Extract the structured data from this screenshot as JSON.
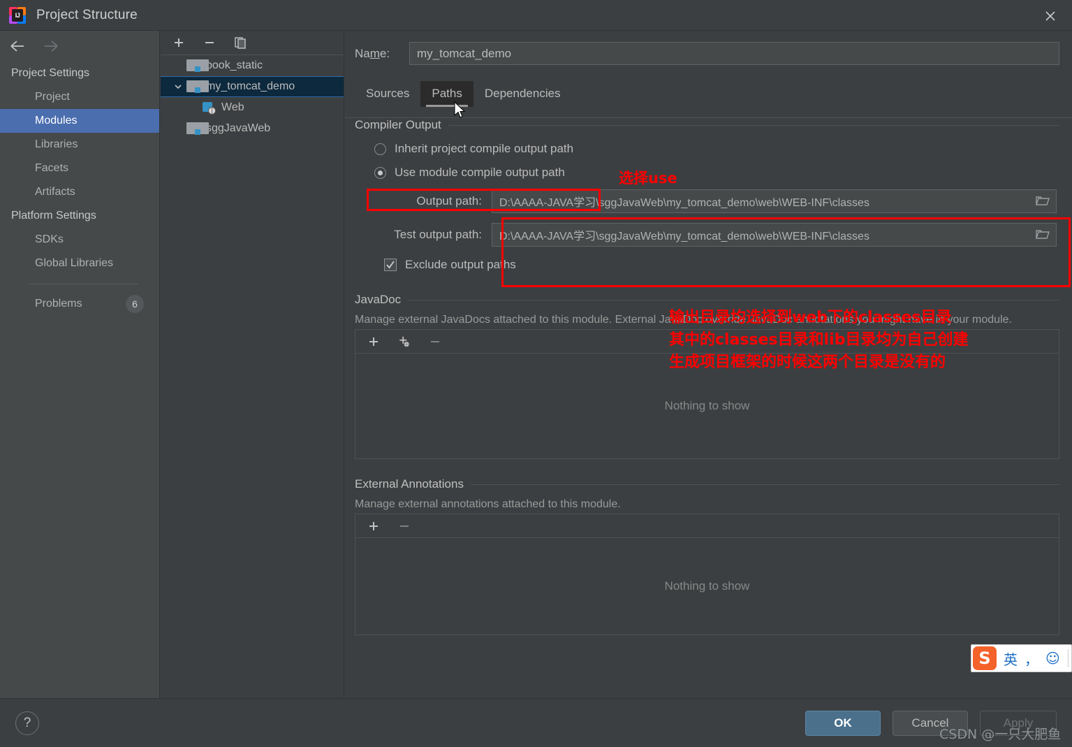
{
  "window": {
    "title": "Project Structure",
    "close_icon": "close-icon",
    "logo_text": "IJ"
  },
  "sidebar": {
    "back_icon": "arrow-left-icon",
    "forward_icon": "arrow-right-icon",
    "groups": [
      {
        "label": "Project Settings",
        "items": [
          {
            "label": "Project",
            "selected": false
          },
          {
            "label": "Modules",
            "selected": true
          },
          {
            "label": "Libraries",
            "selected": false
          },
          {
            "label": "Facets",
            "selected": false
          },
          {
            "label": "Artifacts",
            "selected": false
          }
        ]
      },
      {
        "label": "Platform Settings",
        "items": [
          {
            "label": "SDKs",
            "selected": false
          },
          {
            "label": "Global Libraries",
            "selected": false
          }
        ]
      }
    ],
    "problems": {
      "label": "Problems",
      "count": "6"
    }
  },
  "tree": {
    "toolbar": [
      {
        "name": "add-module-button",
        "icon": "plus-icon"
      },
      {
        "name": "remove-module-button",
        "icon": "minus-icon"
      },
      {
        "name": "copy-module-button",
        "icon": "copy-icon"
      }
    ],
    "nodes": [
      {
        "label": "book_static",
        "icon": "module-folder-icon",
        "indent": 1,
        "expander": "",
        "selected": false
      },
      {
        "label": "my_tomcat_demo",
        "icon": "module-folder-icon",
        "indent": 0,
        "expander": "chevron-down-icon",
        "selected": true
      },
      {
        "label": "Web",
        "icon": "web-facet-icon",
        "indent": 2,
        "expander": "",
        "selected": false
      },
      {
        "label": "sggJavaWeb",
        "icon": "module-folder-icon",
        "indent": 1,
        "expander": "",
        "selected": false
      }
    ]
  },
  "main": {
    "name_label": "Name:",
    "name_value": "my_tomcat_demo",
    "tabs": [
      {
        "label": "Sources",
        "active": false
      },
      {
        "label": "Paths",
        "active": true
      },
      {
        "label": "Dependencies",
        "active": false
      }
    ],
    "compiler_output": {
      "section_title": "Compiler Output",
      "radio_inherit": "Inherit project compile output path",
      "radio_use": "Use module compile output path",
      "selected": "use",
      "output_path_label": "Output path:",
      "output_path_value": "D:\\AAAA-JAVA学习\\sggJavaWeb\\my_tomcat_demo\\web\\WEB-INF\\classes",
      "test_output_path_label": "Test output path:",
      "test_output_path_value": "D:\\AAAA-JAVA学习\\sggJavaWeb\\my_tomcat_demo\\web\\WEB-INF\\classes",
      "browse_icon": "folder-browse-icon",
      "exclude_label": "Exclude output paths",
      "exclude_checked": true
    },
    "javadoc": {
      "section_title": "JavaDoc",
      "description": "Manage external JavaDocs attached to this module. External JavaDoc override JavaDoc annotations you might have in your module.",
      "toolbar": [
        {
          "name": "javadoc-add-button",
          "icon": "plus-icon"
        },
        {
          "name": "javadoc-add-url-button",
          "icon": "plus-globe-icon"
        },
        {
          "name": "javadoc-remove-button",
          "icon": "minus-icon"
        }
      ],
      "empty_text": "Nothing to show"
    },
    "external_annotations": {
      "section_title": "External Annotations",
      "description": "Manage external annotations attached to this module.",
      "toolbar": [
        {
          "name": "annotations-add-button",
          "icon": "plus-icon"
        },
        {
          "name": "annotations-remove-button",
          "icon": "minus-icon"
        }
      ],
      "empty_text": "Nothing to show"
    }
  },
  "annotations": {
    "select_use": "选择use",
    "note_line1": "输出目录均选择到web下的classes目录",
    "note_line2": "其中的classes目录和lib目录均为自己创建",
    "note_line3": "生成项目框架的时候这两个目录是没有的",
    "color": "#ff0000"
  },
  "footer": {
    "help_icon": "question-mark-icon",
    "ok": "OK",
    "cancel": "Cancel",
    "apply": "Apply",
    "watermark": "CSDN @一只大肥鱼"
  },
  "ime": {
    "logo": "S",
    "mode": "英",
    "punctuation": "，",
    "emoji": "☺"
  }
}
